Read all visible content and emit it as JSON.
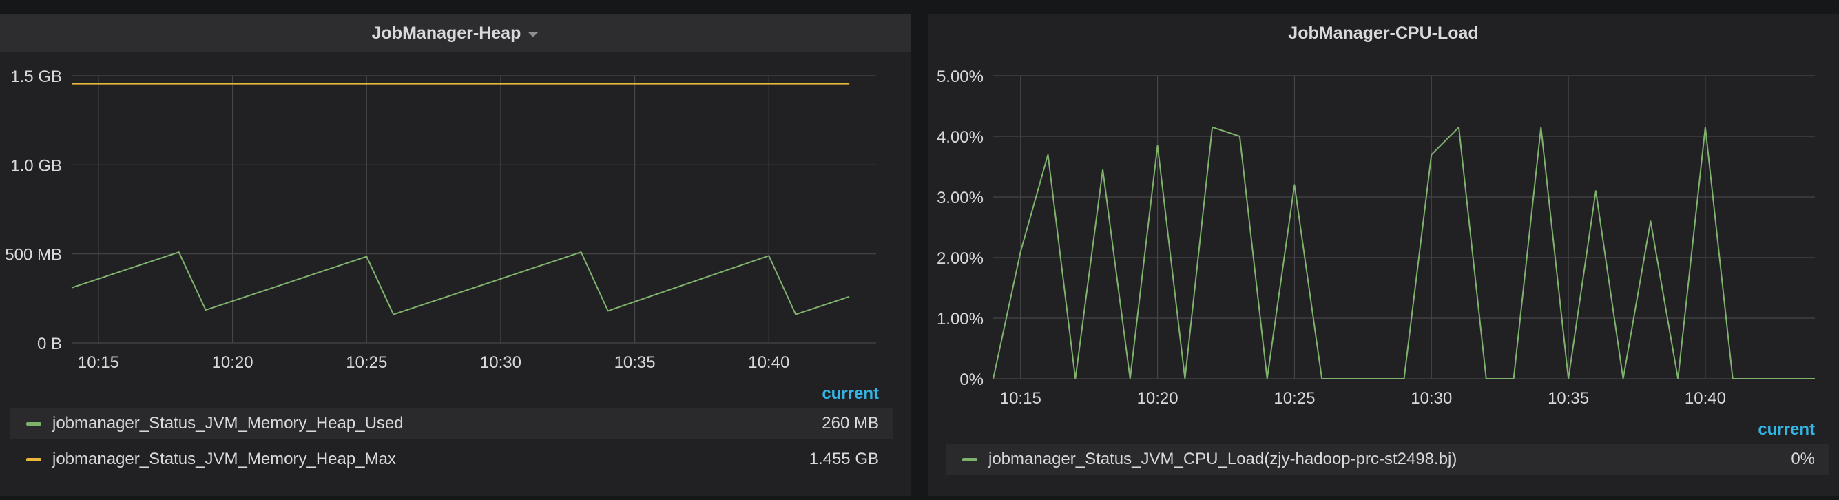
{
  "colors": {
    "background": "#161719",
    "panel": "#212124",
    "grid": "#464648",
    "used": "#7eb26d",
    "max": "#eab839",
    "cpu": "#7eb26d",
    "legend_header": "#33b5e5"
  },
  "panels": [
    {
      "title": "JobManager-Heap",
      "has_dropdown": true,
      "legend_header": "current",
      "legend": [
        {
          "name": "jobmanager_Status_JVM_Memory_Heap_Used",
          "value": "260 MB",
          "color": "#7eb26d"
        },
        {
          "name": "jobmanager_Status_JVM_Memory_Heap_Max",
          "value": "1.455 GB",
          "color": "#eab839"
        }
      ]
    },
    {
      "title": "JobManager-CPU-Load",
      "has_dropdown": false,
      "legend_header": "current",
      "legend": [
        {
          "name": "jobmanager_Status_JVM_CPU_Load(zjy-hadoop-prc-st2498.bj)",
          "value": "0%",
          "color": "#7eb26d"
        }
      ]
    }
  ],
  "chart_data": [
    {
      "type": "line",
      "title": "JobManager-Heap",
      "x_unit": "minutes",
      "xlim": [
        "10:14",
        "10:44"
      ],
      "x_ticks": [
        "10:15",
        "10:20",
        "10:25",
        "10:30",
        "10:35",
        "10:40"
      ],
      "y_unit": "MB",
      "ylim": [
        0,
        1500
      ],
      "y_ticks": [
        {
          "value": 0,
          "label": "0 B"
        },
        {
          "value": 500,
          "label": "500 MB"
        },
        {
          "value": 1000,
          "label": "1.0 GB"
        },
        {
          "value": 1500,
          "label": "1.5 GB"
        }
      ],
      "grid": true,
      "series": [
        {
          "name": "jobmanager_Status_JVM_Memory_Heap_Used",
          "color": "#7eb26d",
          "x": [
            "10:14",
            "10:18",
            "10:19",
            "10:25",
            "10:26",
            "10:33",
            "10:34",
            "10:40",
            "10:41",
            "10:43"
          ],
          "y": [
            310,
            510,
            185,
            485,
            160,
            510,
            180,
            490,
            160,
            260
          ]
        },
        {
          "name": "jobmanager_Status_JVM_Memory_Heap_Max",
          "color": "#eab839",
          "x": [
            "10:14",
            "10:43"
          ],
          "y": [
            1455,
            1455
          ]
        }
      ]
    },
    {
      "type": "line",
      "title": "JobManager-CPU-Load",
      "x_unit": "minutes",
      "xlim": [
        "10:14",
        "10:44"
      ],
      "x_ticks": [
        "10:15",
        "10:20",
        "10:25",
        "10:30",
        "10:35",
        "10:40"
      ],
      "y_unit": "percent",
      "ylim": [
        0,
        5
      ],
      "y_ticks": [
        {
          "value": 0,
          "label": "0%"
        },
        {
          "value": 1,
          "label": "1.00%"
        },
        {
          "value": 2,
          "label": "2.00%"
        },
        {
          "value": 3,
          "label": "3.00%"
        },
        {
          "value": 4,
          "label": "4.00%"
        },
        {
          "value": 5,
          "label": "5.00%"
        }
      ],
      "grid": true,
      "series": [
        {
          "name": "jobmanager_Status_JVM_CPU_Load(zjy-hadoop-prc-st2498.bj)",
          "color": "#7eb26d",
          "x": [
            "10:14",
            "10:15",
            "10:16",
            "10:17",
            "10:18",
            "10:19",
            "10:20",
            "10:21",
            "10:22",
            "10:23",
            "10:24",
            "10:25",
            "10:26",
            "10:29",
            "10:30",
            "10:31",
            "10:32",
            "10:33",
            "10:34",
            "10:35",
            "10:36",
            "10:37",
            "10:38",
            "10:39",
            "10:40",
            "10:41",
            "10:44"
          ],
          "y": [
            0,
            2.1,
            3.7,
            0,
            3.45,
            0,
            3.85,
            0,
            4.15,
            4.0,
            0,
            3.2,
            0,
            0,
            3.7,
            4.15,
            0,
            0,
            4.15,
            0,
            3.1,
            0,
            2.6,
            0,
            4.15,
            0,
            0
          ]
        }
      ]
    }
  ]
}
